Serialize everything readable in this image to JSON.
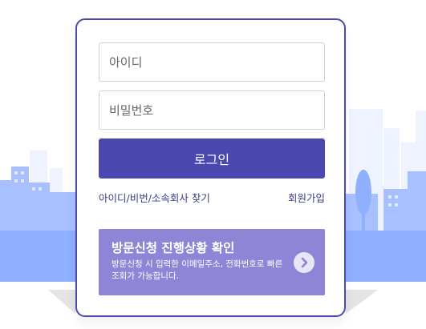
{
  "login_form": {
    "id_placeholder": "아이디",
    "password_placeholder": "비밀번호",
    "login_label": "로그인",
    "find_account_link": "아이디/비번/소속회사 찾기",
    "signup_link": "회원가입"
  },
  "visit_status": {
    "title": "방문신청 진행상황 확인",
    "description": "방문신청 시 입력한 이메일주소, 전화번호로 빠른 조회가 가능합니다.",
    "icon": "chevron-right-icon"
  },
  "colors": {
    "accent": "#4b49b0",
    "visit_box": "#8f85d6",
    "city_light": "#dfe8ff",
    "city_mid": "#8fb0ff"
  }
}
